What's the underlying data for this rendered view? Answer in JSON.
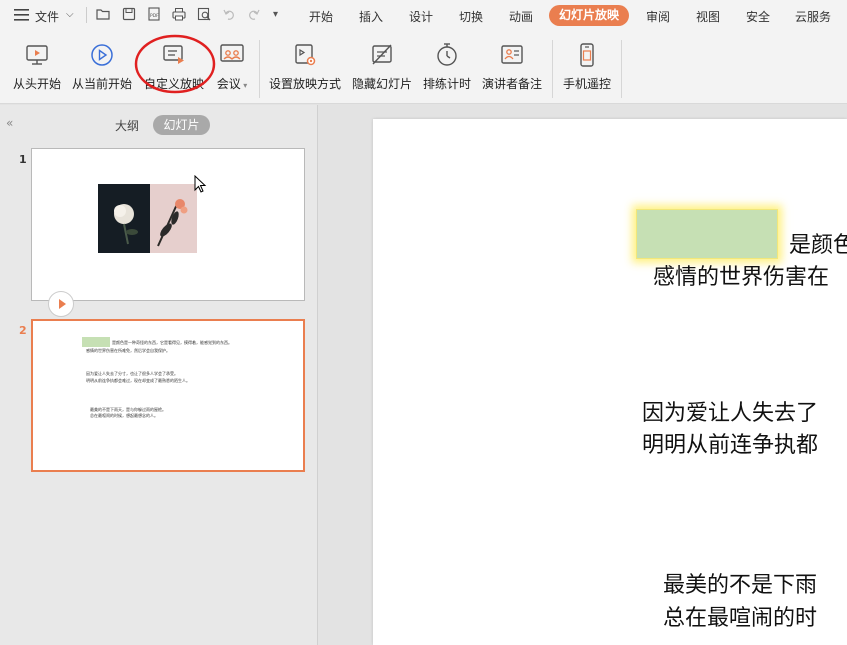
{
  "menubar": {
    "file_label": "文件",
    "tabs": [
      "开始",
      "插入",
      "设计",
      "切换",
      "动画",
      "幻灯片放映",
      "审阅",
      "视图",
      "安全",
      "云服务"
    ],
    "active_tab": "幻灯片放映"
  },
  "ribbon": {
    "buttons": [
      {
        "label": "从头开始",
        "icon": "monitor-play-icon"
      },
      {
        "label": "从当前开始",
        "icon": "circle-play-icon"
      },
      {
        "label": "自定义放映",
        "icon": "custom-show-icon"
      },
      {
        "label": "会议",
        "icon": "meeting-icon"
      },
      {
        "label": "设置放映方式",
        "icon": "setup-show-icon"
      },
      {
        "label": "隐藏幻灯片",
        "icon": "hide-slide-icon"
      },
      {
        "label": "排练计时",
        "icon": "stopwatch-icon"
      },
      {
        "label": "演讲者备注",
        "icon": "speaker-notes-icon"
      },
      {
        "label": "手机遥控",
        "icon": "phone-remote-icon"
      }
    ],
    "annotation": "red-circle-highlight"
  },
  "panel": {
    "outline_tab": "大纲",
    "slides_tab": "幻灯片",
    "slides": [
      {
        "number": "1"
      },
      {
        "number": "2"
      }
    ]
  },
  "slide": {
    "para1": [
      "是颜色",
      "感情的世界伤害在"
    ],
    "para2": [
      "因为爱让人失去了",
      "明明从前连争执都"
    ],
    "para3": [
      "最美的不是下雨",
      "总在最喧闹的时"
    ]
  },
  "thumb2_text": {
    "l1": "是颜色是一种奇怪的东西，它是看得见，摸得着，能感觉到的东西。",
    "l2": "感情的世界伤害在所难免，然后学会自我保护。",
    "l3": "因为爱让人失去了分寸，也让了很多人学会了承受。",
    "l4": "明明从前连争执都会难过，现在却变成了最熟悉的陌生人。",
    "l5": "最美的不是下雨天，是与你躲过雨的屋檐。",
    "l6": "总在最喧闹的时候，想起最想念的人。"
  },
  "colors": {
    "accent": "#ea7e4f",
    "highlight_box": "#c6e0b4",
    "annotation_circle": "#e02020"
  }
}
